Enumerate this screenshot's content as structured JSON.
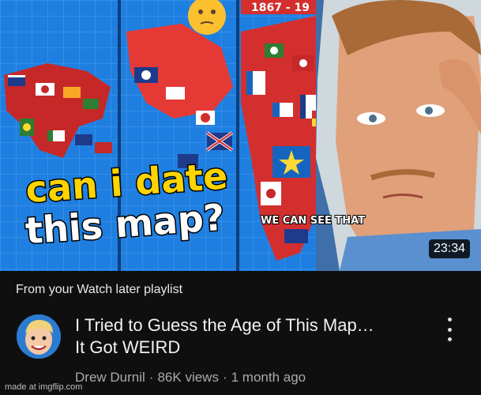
{
  "video": {
    "duration": "23:34",
    "thumbnail_text": {
      "line1": "can i date",
      "line2": "this map?",
      "caption": "WE CAN SEE THAT",
      "year_banner": "1867 - 19"
    },
    "source": "From your Watch later playlist",
    "title_line1": "I Tried to Guess the Age of This Map…",
    "title_line2": "It Got WEIRD",
    "channel": "Drew Durnil",
    "separator": "·",
    "views": "86K views",
    "age": "1 month ago"
  },
  "watermark": "made at imgflip.com",
  "colors": {
    "background": "#0f0f0f",
    "map_blue": "#1f7fe0",
    "thumbnail_text_yellow": "#ffd400"
  }
}
